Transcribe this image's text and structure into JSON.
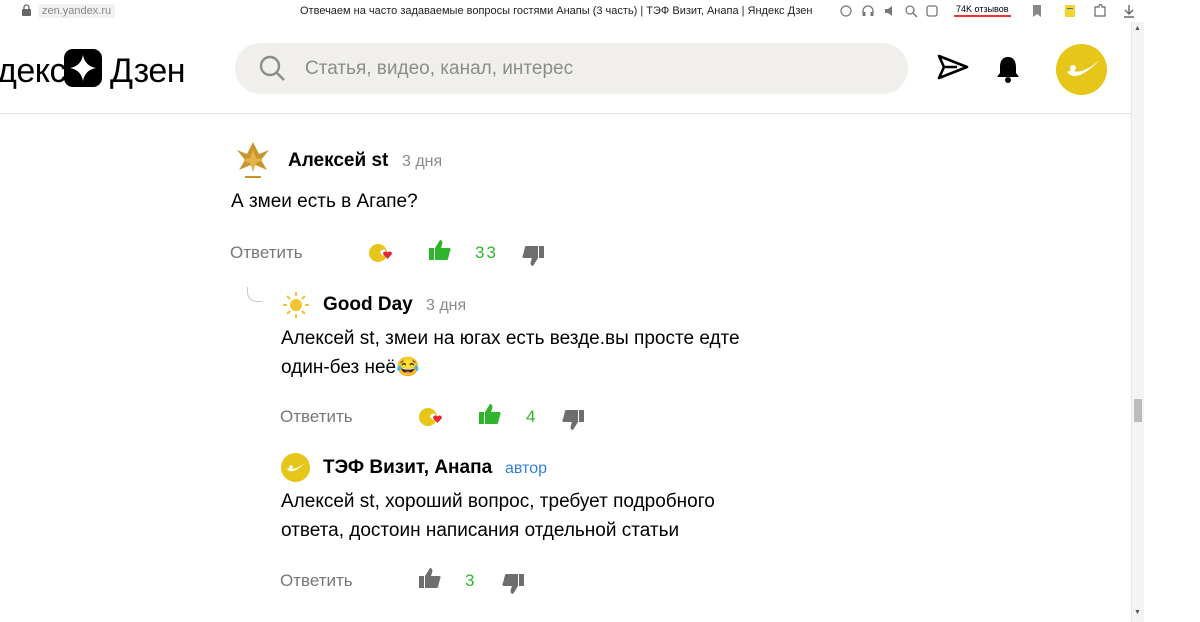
{
  "browser": {
    "url": "zen.yandex.ru",
    "title": "Отвечаем на часто задаваемые вопросы гостями Анапы (3 часть) | ТЭФ Визит, Анапа | Яндекс Дзен",
    "reviews_badge": "74K отзывов"
  },
  "header": {
    "logo_left": "декс",
    "logo_right": "Дзен",
    "search_placeholder": "Статья, видео, канал, интерес"
  },
  "comments": [
    {
      "author": "Алексей st",
      "time": "3 дня",
      "text": "А змеи есть в Агапе?",
      "reply_label": "Ответить",
      "likes": "33"
    },
    {
      "author": "Good Day",
      "time": "3 дня",
      "text_line1": "Алексей st, змеи на югах есть везде.вы просте едте",
      "text_line2": "один-без неё😂",
      "reply_label": "Ответить",
      "likes": "4"
    },
    {
      "author": "ТЭФ Визит, Анапа",
      "author_tag": "автор",
      "text_line1": "Алексей st, хороший вопрос, требует подробного",
      "text_line2": "ответа, достоин написания отдельной статьи",
      "reply_label": "Ответить",
      "likes": "3"
    }
  ],
  "colors": {
    "accent_yellow": "#e6c618",
    "like_green": "#2fb52c",
    "author_blue": "#2f80e0"
  }
}
